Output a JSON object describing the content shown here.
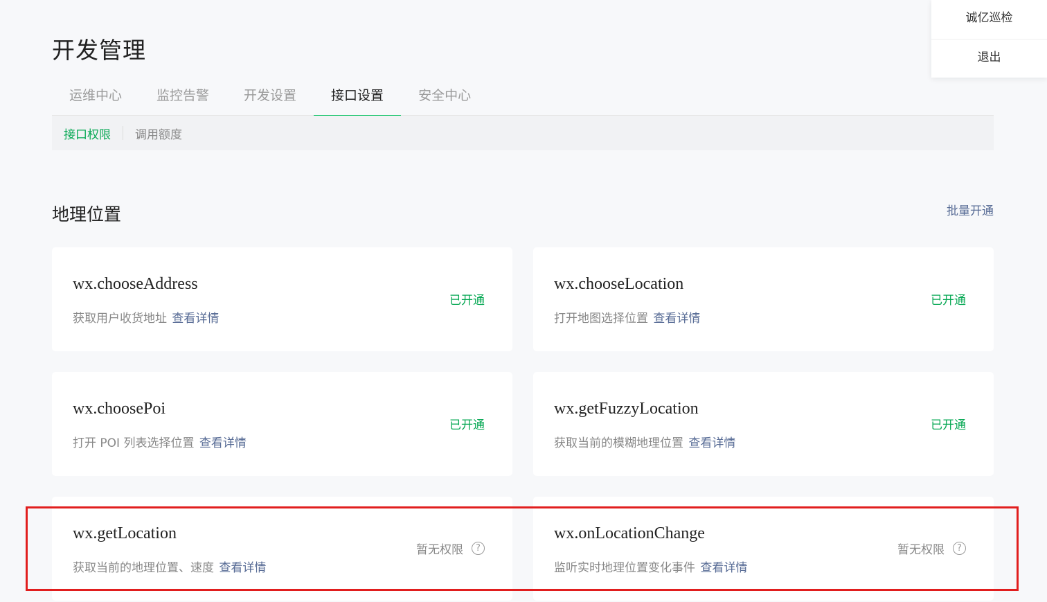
{
  "page_title": "开发管理",
  "tabs": [
    {
      "label": "运维中心",
      "active": false
    },
    {
      "label": "监控告警",
      "active": false
    },
    {
      "label": "开发设置",
      "active": false
    },
    {
      "label": "接口设置",
      "active": true
    },
    {
      "label": "安全中心",
      "active": false
    }
  ],
  "subtabs": [
    {
      "label": "接口权限",
      "active": true
    },
    {
      "label": "调用额度",
      "active": false
    }
  ],
  "section": {
    "title": "地理位置",
    "batch_label": "批量开通"
  },
  "apis": [
    {
      "name": "wx.chooseAddress",
      "desc": "获取用户收货地址",
      "detail": "查看详情",
      "status": "已开通",
      "enabled": true
    },
    {
      "name": "wx.chooseLocation",
      "desc": "打开地图选择位置",
      "detail": "查看详情",
      "status": "已开通",
      "enabled": true
    },
    {
      "name": "wx.choosePoi",
      "desc": "打开 POI 列表选择位置",
      "detail": "查看详情",
      "status": "已开通",
      "enabled": true
    },
    {
      "name": "wx.getFuzzyLocation",
      "desc": "获取当前的模糊地理位置",
      "detail": "查看详情",
      "status": "已开通",
      "enabled": true
    },
    {
      "name": "wx.getLocation",
      "desc": "获取当前的地理位置、速度",
      "detail": "查看详情",
      "status": "暂无权限",
      "enabled": false
    },
    {
      "name": "wx.onLocationChange",
      "desc": "监听实时地理位置变化事件",
      "detail": "查看详情",
      "status": "暂无权限",
      "enabled": false
    }
  ],
  "user_menu": {
    "account_name": "诚亿巡检",
    "logout_label": "退出"
  },
  "colors": {
    "accent_green": "#07c160",
    "link_blue": "#576b95",
    "highlight_red": "#e11e1e"
  }
}
